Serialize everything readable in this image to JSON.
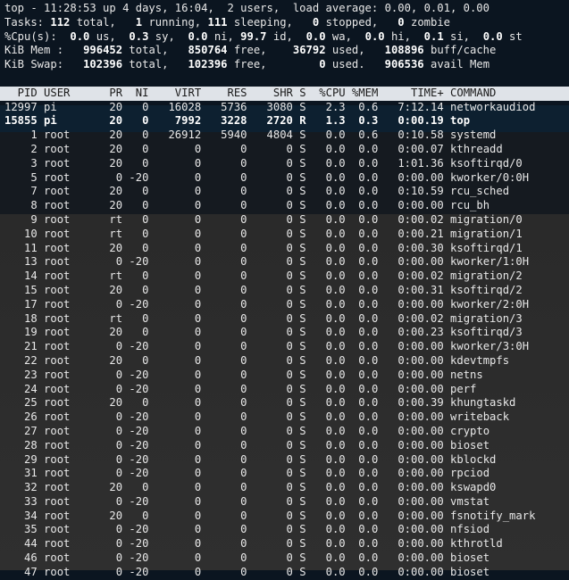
{
  "summary": [
    [
      {
        "t": "top - 11:28:53 up 4 days, 16:04,  2 users,  load average: 0.00, 0.01, 0.00"
      }
    ],
    [
      {
        "t": "Tasks: "
      },
      {
        "t": "112",
        "b": 1
      },
      {
        "t": " total,   "
      },
      {
        "t": "1",
        "b": 1
      },
      {
        "t": " running, "
      },
      {
        "t": "111",
        "b": 1
      },
      {
        "t": " sleeping,   "
      },
      {
        "t": "0",
        "b": 1
      },
      {
        "t": " stopped,   "
      },
      {
        "t": "0",
        "b": 1
      },
      {
        "t": " zombie"
      }
    ],
    [
      {
        "t": "%Cpu(s):  "
      },
      {
        "t": "0.0",
        "b": 1
      },
      {
        "t": " us,  "
      },
      {
        "t": "0.3",
        "b": 1
      },
      {
        "t": " sy,  "
      },
      {
        "t": "0.0",
        "b": 1
      },
      {
        "t": " ni, "
      },
      {
        "t": "99.7",
        "b": 1
      },
      {
        "t": " id,  "
      },
      {
        "t": "0.0",
        "b": 1
      },
      {
        "t": " wa,  "
      },
      {
        "t": "0.0",
        "b": 1
      },
      {
        "t": " hi,  "
      },
      {
        "t": "0.1",
        "b": 1
      },
      {
        "t": " si,  "
      },
      {
        "t": "0.0",
        "b": 1
      },
      {
        "t": " st"
      }
    ],
    [
      {
        "t": "KiB Mem :   "
      },
      {
        "t": "996452",
        "b": 1
      },
      {
        "t": " total,   "
      },
      {
        "t": "850764",
        "b": 1
      },
      {
        "t": " free,    "
      },
      {
        "t": "36792",
        "b": 1
      },
      {
        "t": " used,   "
      },
      {
        "t": "108896",
        "b": 1
      },
      {
        "t": " buff/cache"
      }
    ],
    [
      {
        "t": "KiB Swap:   "
      },
      {
        "t": "102396",
        "b": 1
      },
      {
        "t": " total,   "
      },
      {
        "t": "102396",
        "b": 1
      },
      {
        "t": " free,        "
      },
      {
        "t": "0",
        "b": 1
      },
      {
        "t": " used.   "
      },
      {
        "t": "906536",
        "b": 1
      },
      {
        "t": " avail Mem"
      }
    ]
  ],
  "columns": [
    "PID",
    "USER",
    "PR",
    "NI",
    "VIRT",
    "RES",
    "SHR",
    "S",
    "%CPU",
    "%MEM",
    "TIME+",
    "COMMAND"
  ],
  "processes": [
    [
      "12997",
      "pi",
      "20",
      "0",
      "16028",
      "5736",
      "3080",
      "S",
      "2.3",
      "0.6",
      "7:12.14",
      "networkaudiod"
    ],
    [
      "15855",
      "pi",
      "20",
      "0",
      "7992",
      "3228",
      "2720",
      "R",
      "1.3",
      "0.3",
      "0:00.19",
      "top"
    ],
    [
      "1",
      "root",
      "20",
      "0",
      "26912",
      "5940",
      "4804",
      "S",
      "0.0",
      "0.6",
      "0:10.58",
      "systemd"
    ],
    [
      "2",
      "root",
      "20",
      "0",
      "0",
      "0",
      "0",
      "S",
      "0.0",
      "0.0",
      "0:00.07",
      "kthreadd"
    ],
    [
      "3",
      "root",
      "20",
      "0",
      "0",
      "0",
      "0",
      "S",
      "0.0",
      "0.0",
      "1:01.36",
      "ksoftirqd/0"
    ],
    [
      "5",
      "root",
      "0",
      "-20",
      "0",
      "0",
      "0",
      "S",
      "0.0",
      "0.0",
      "0:00.00",
      "kworker/0:0H"
    ],
    [
      "7",
      "root",
      "20",
      "0",
      "0",
      "0",
      "0",
      "S",
      "0.0",
      "0.0",
      "0:10.59",
      "rcu_sched"
    ],
    [
      "8",
      "root",
      "20",
      "0",
      "0",
      "0",
      "0",
      "S",
      "0.0",
      "0.0",
      "0:00.00",
      "rcu_bh"
    ],
    [
      "9",
      "root",
      "rt",
      "0",
      "0",
      "0",
      "0",
      "S",
      "0.0",
      "0.0",
      "0:00.02",
      "migration/0"
    ],
    [
      "10",
      "root",
      "rt",
      "0",
      "0",
      "0",
      "0",
      "S",
      "0.0",
      "0.0",
      "0:00.21",
      "migration/1"
    ],
    [
      "11",
      "root",
      "20",
      "0",
      "0",
      "0",
      "0",
      "S",
      "0.0",
      "0.0",
      "0:00.30",
      "ksoftirqd/1"
    ],
    [
      "13",
      "root",
      "0",
      "-20",
      "0",
      "0",
      "0",
      "S",
      "0.0",
      "0.0",
      "0:00.00",
      "kworker/1:0H"
    ],
    [
      "14",
      "root",
      "rt",
      "0",
      "0",
      "0",
      "0",
      "S",
      "0.0",
      "0.0",
      "0:00.02",
      "migration/2"
    ],
    [
      "15",
      "root",
      "20",
      "0",
      "0",
      "0",
      "0",
      "S",
      "0.0",
      "0.0",
      "0:00.31",
      "ksoftirqd/2"
    ],
    [
      "17",
      "root",
      "0",
      "-20",
      "0",
      "0",
      "0",
      "S",
      "0.0",
      "0.0",
      "0:00.00",
      "kworker/2:0H"
    ],
    [
      "18",
      "root",
      "rt",
      "0",
      "0",
      "0",
      "0",
      "S",
      "0.0",
      "0.0",
      "0:00.02",
      "migration/3"
    ],
    [
      "19",
      "root",
      "20",
      "0",
      "0",
      "0",
      "0",
      "S",
      "0.0",
      "0.0",
      "0:00.23",
      "ksoftirqd/3"
    ],
    [
      "21",
      "root",
      "0",
      "-20",
      "0",
      "0",
      "0",
      "S",
      "0.0",
      "0.0",
      "0:00.00",
      "kworker/3:0H"
    ],
    [
      "22",
      "root",
      "20",
      "0",
      "0",
      "0",
      "0",
      "S",
      "0.0",
      "0.0",
      "0:00.00",
      "kdevtmpfs"
    ],
    [
      "23",
      "root",
      "0",
      "-20",
      "0",
      "0",
      "0",
      "S",
      "0.0",
      "0.0",
      "0:00.00",
      "netns"
    ],
    [
      "24",
      "root",
      "0",
      "-20",
      "0",
      "0",
      "0",
      "S",
      "0.0",
      "0.0",
      "0:00.00",
      "perf"
    ],
    [
      "25",
      "root",
      "20",
      "0",
      "0",
      "0",
      "0",
      "S",
      "0.0",
      "0.0",
      "0:00.39",
      "khungtaskd"
    ],
    [
      "26",
      "root",
      "0",
      "-20",
      "0",
      "0",
      "0",
      "S",
      "0.0",
      "0.0",
      "0:00.00",
      "writeback"
    ],
    [
      "27",
      "root",
      "0",
      "-20",
      "0",
      "0",
      "0",
      "S",
      "0.0",
      "0.0",
      "0:00.00",
      "crypto"
    ],
    [
      "28",
      "root",
      "0",
      "-20",
      "0",
      "0",
      "0",
      "S",
      "0.0",
      "0.0",
      "0:00.00",
      "bioset"
    ],
    [
      "29",
      "root",
      "0",
      "-20",
      "0",
      "0",
      "0",
      "S",
      "0.0",
      "0.0",
      "0:00.00",
      "kblockd"
    ],
    [
      "31",
      "root",
      "0",
      "-20",
      "0",
      "0",
      "0",
      "S",
      "0.0",
      "0.0",
      "0:00.00",
      "rpciod"
    ],
    [
      "32",
      "root",
      "20",
      "0",
      "0",
      "0",
      "0",
      "S",
      "0.0",
      "0.0",
      "0:00.00",
      "kswapd0"
    ],
    [
      "33",
      "root",
      "0",
      "-20",
      "0",
      "0",
      "0",
      "S",
      "0.0",
      "0.0",
      "0:00.00",
      "vmstat"
    ],
    [
      "34",
      "root",
      "20",
      "0",
      "0",
      "0",
      "0",
      "S",
      "0.0",
      "0.0",
      "0:00.00",
      "fsnotify_mark"
    ],
    [
      "35",
      "root",
      "0",
      "-20",
      "0",
      "0",
      "0",
      "S",
      "0.0",
      "0.0",
      "0:00.00",
      "nfsiod"
    ],
    [
      "44",
      "root",
      "0",
      "-20",
      "0",
      "0",
      "0",
      "S",
      "0.0",
      "0.0",
      "0:00.00",
      "kthrotld"
    ],
    [
      "46",
      "root",
      "0",
      "-20",
      "0",
      "0",
      "0",
      "S",
      "0.0",
      "0.0",
      "0:00.00",
      "bioset"
    ],
    [
      "47",
      "root",
      "0",
      "-20",
      "0",
      "0",
      "0",
      "S",
      "0.0",
      "0.0",
      "0:00.00",
      "bioset"
    ]
  ],
  "highlighted_pid": "15855"
}
